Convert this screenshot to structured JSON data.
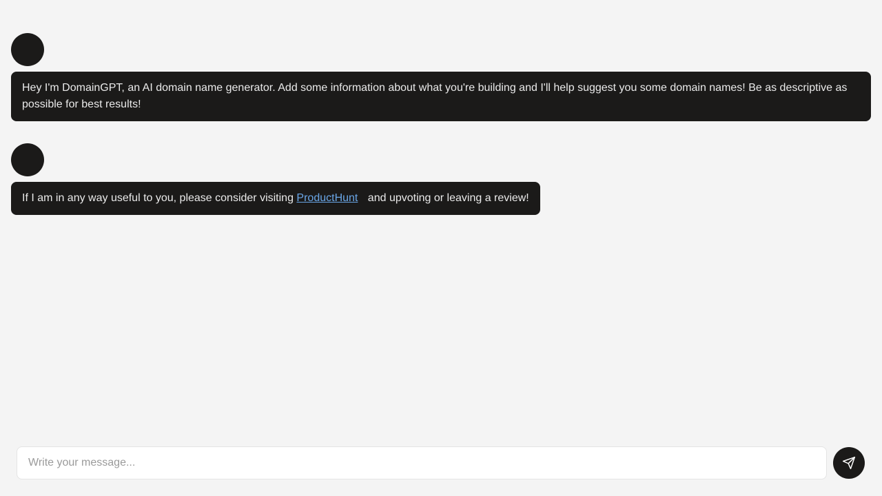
{
  "messages": [
    {
      "text": "Hey I'm DomainGPT, an AI domain name generator. Add some information about what you're building and I'll help suggest you some domain names! Be as descriptive as possible for best results!"
    },
    {
      "text_before": "If I am in any way useful to you, please consider visiting ",
      "link_text": "ProductHunt",
      "text_after": " and upvoting or leaving a review!"
    }
  ],
  "composer": {
    "placeholder": "Write your message...",
    "value": ""
  },
  "icons": {
    "send": "send-icon"
  },
  "colors": {
    "bubble_bg": "#1b1a19",
    "bubble_text": "#eaeaea",
    "link": "#6aa7e8",
    "page_bg": "#f4f4f4"
  }
}
